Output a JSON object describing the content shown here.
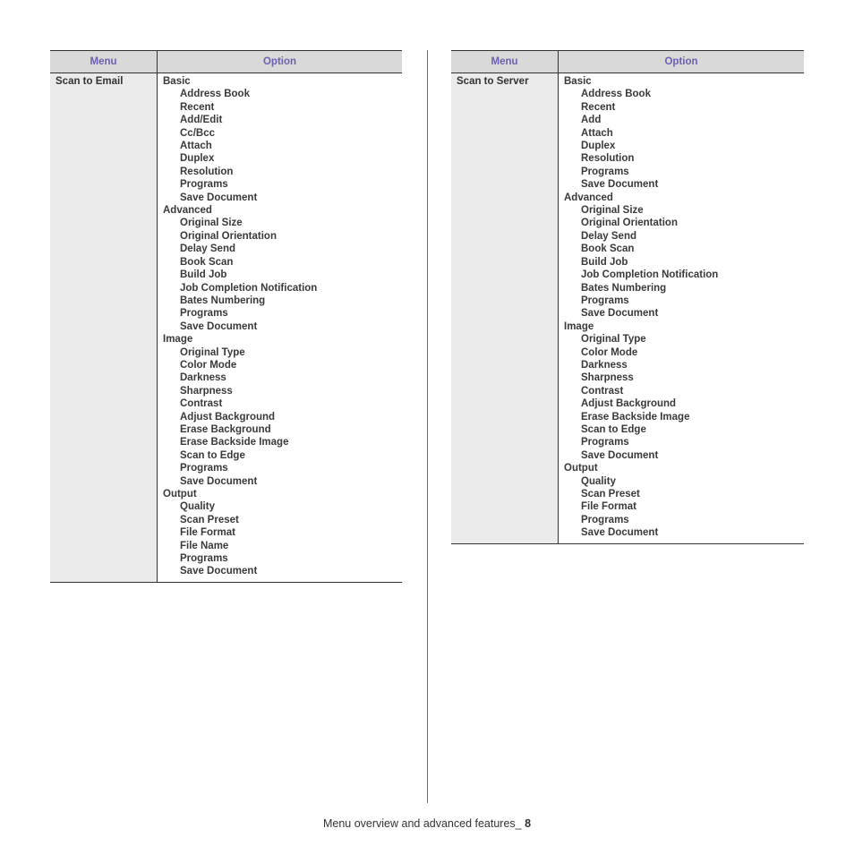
{
  "tables": [
    {
      "headers": {
        "menu": "Menu",
        "option": "Option"
      },
      "menu": "Scan to Email",
      "groups": [
        {
          "label": "Basic",
          "items": [
            "Address Book",
            "Recent",
            "Add/Edit",
            "Cc/Bcc",
            "Attach",
            "Duplex",
            "Resolution",
            "Programs",
            "Save Document"
          ]
        },
        {
          "label": "Advanced",
          "items": [
            "Original Size",
            "Original Orientation",
            "Delay Send",
            "Book Scan",
            "Build Job",
            "Job Completion Notification",
            "Bates Numbering",
            "Programs",
            "Save Document"
          ]
        },
        {
          "label": "Image",
          "items": [
            "Original Type",
            "Color Mode",
            "Darkness",
            "Sharpness",
            "Contrast",
            "Adjust Background",
            "Erase Background",
            "Erase Backside Image",
            "Scan to Edge",
            "Programs",
            "Save Document"
          ]
        },
        {
          "label": "Output",
          "items": [
            "Quality",
            "Scan Preset",
            "File Format",
            "File Name",
            "Programs",
            "Save Document"
          ]
        }
      ]
    },
    {
      "headers": {
        "menu": "Menu",
        "option": "Option"
      },
      "menu": "Scan to Server",
      "groups": [
        {
          "label": "Basic",
          "items": [
            "Address Book",
            "Recent",
            "Add",
            "Attach",
            "Duplex",
            "Resolution",
            "Programs",
            "Save Document"
          ]
        },
        {
          "label": "Advanced",
          "items": [
            "Original Size",
            "Original Orientation",
            "Delay Send",
            "Book Scan",
            "Build Job",
            "Job Completion Notification",
            "Bates Numbering",
            "Programs",
            "Save Document"
          ]
        },
        {
          "label": "Image",
          "items": [
            "Original Type",
            "Color Mode",
            "Darkness",
            "Sharpness",
            "Contrast",
            "Adjust Background",
            "Erase Backside Image",
            "Scan to Edge",
            "Programs",
            "Save Document"
          ]
        },
        {
          "label": "Output",
          "items": [
            "Quality",
            "Scan Preset",
            "File Format",
            "Programs",
            "Save Document"
          ]
        }
      ]
    }
  ],
  "footer": {
    "text": "Menu overview and advanced features_ ",
    "page_number": "8"
  },
  "colors": {
    "header_text": "#6e5fb0",
    "header_bg": "#d9d9d9",
    "menu_cell_bg": "#ebebeb",
    "divider": "#6e5fb0"
  }
}
